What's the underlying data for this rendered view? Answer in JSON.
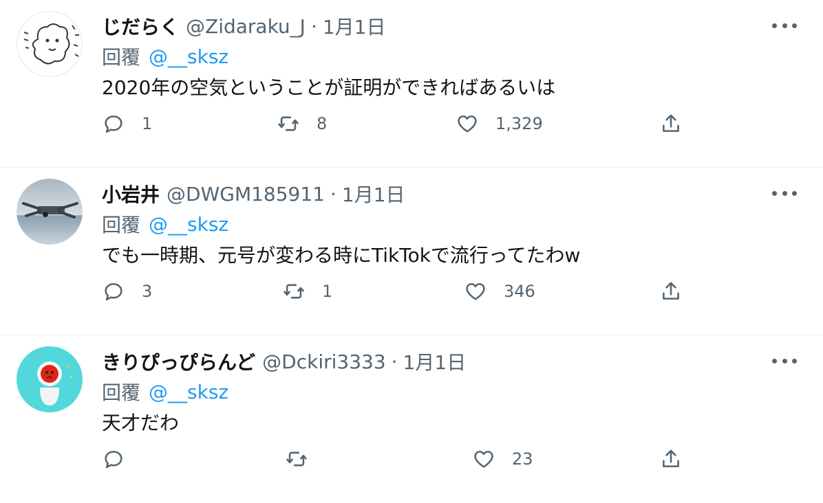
{
  "tweets": [
    {
      "name": "じだらく",
      "handle": "@Zidaraku_J",
      "dot": "·",
      "date": "1月1日",
      "reply_label": "回覆",
      "reply_to": "@__sksz",
      "text": "2020年の空気ということが証明ができればあるいは",
      "replies": "1",
      "retweets": "8",
      "likes": "1,329"
    },
    {
      "name": "小岩井",
      "handle": "@DWGM185911",
      "dot": "·",
      "date": "1月1日",
      "reply_label": "回覆",
      "reply_to": "@__sksz",
      "text": "でも一時期、元号が変わる時にTikTokで流行ってたわw",
      "replies": "3",
      "retweets": "1",
      "likes": "346"
    },
    {
      "name": "きりぴっぴらんど",
      "handle": "@Dckiri3333",
      "dot": "·",
      "date": "1月1日",
      "reply_label": "回覆",
      "reply_to": "@__sksz",
      "text": "天才だわ",
      "replies": "",
      "retweets": "",
      "likes": "23"
    }
  ],
  "icons": {
    "reply": "reply-icon",
    "retweet": "retweet-icon",
    "like": "heart-icon",
    "share": "share-icon",
    "more": "more-icon"
  },
  "colors": {
    "text": "#0f1419",
    "secondary": "#536471",
    "accent": "#1d9bf0",
    "divider": "#eff3f4"
  }
}
